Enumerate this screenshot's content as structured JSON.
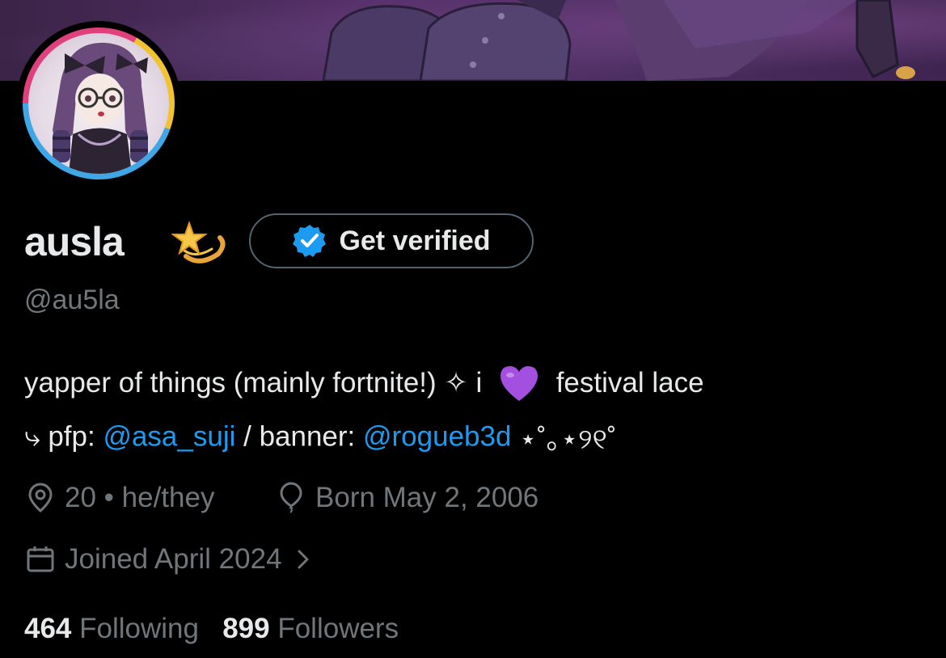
{
  "profile": {
    "display_name": "ausla",
    "name_emoji": "dizzy-star-emoji",
    "handle": "@au5la"
  },
  "verify": {
    "label": "Get verified",
    "badge_color": "#1d9bf0"
  },
  "bio": {
    "line1_text": "yapper of things (mainly fortnite!) ✧ i",
    "heart_emoji": "purple-heart-emoji",
    "line1_tail": "festival lace",
    "line2_prefix": "⤷ pfp: ",
    "pfp_link": "@asa_suji",
    "line2_mid": " / banner: ",
    "banner_link": "@rogueb3d",
    "line2_suffix": " ⋆˚｡⋆୨୧˚"
  },
  "meta": {
    "location": "20 • he/they",
    "born": "Born May 2, 2006",
    "joined": "Joined April 2024"
  },
  "counts": {
    "following_num": "464",
    "following_label": "Following",
    "followers_num": "899",
    "followers_label": "Followers"
  },
  "colors": {
    "background": "#000000",
    "text": "#e7e9ea",
    "muted": "#71767b",
    "link": "#1d9bf0",
    "border": "#536471",
    "ring_pink": "#e0407c",
    "ring_yellow": "#f2c230",
    "ring_blue": "#3fa7e6"
  }
}
